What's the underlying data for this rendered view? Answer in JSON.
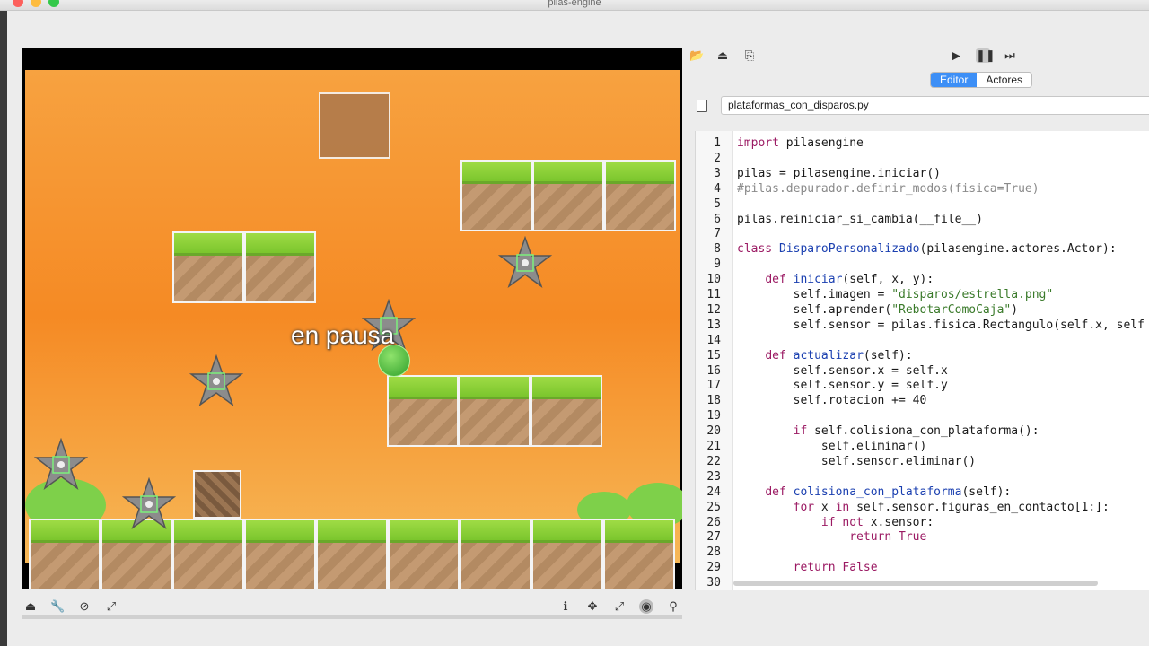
{
  "window": {
    "title": "pilas-engine"
  },
  "game": {
    "pause_label": "en pausa"
  },
  "right_panel": {
    "tabs": [
      {
        "label": "Editor",
        "active": true
      },
      {
        "label": "Actores",
        "active": false
      }
    ],
    "filename": "plataformas_con_disparos.py"
  },
  "editor": {
    "lines": [
      {
        "n": "1",
        "text": "import pilasengine"
      },
      {
        "n": "2",
        "text": ""
      },
      {
        "n": "3",
        "text": "pilas = pilasengine.iniciar()"
      },
      {
        "n": "4",
        "text": "#pilas.depurador.definir_modos(fisica=True)"
      },
      {
        "n": "5",
        "text": ""
      },
      {
        "n": "6",
        "text": "pilas.reiniciar_si_cambia(__file__)"
      },
      {
        "n": "7",
        "text": ""
      },
      {
        "n": "8",
        "text": "class DisparoPersonalizado(pilasengine.actores.Actor):"
      },
      {
        "n": "9",
        "text": ""
      },
      {
        "n": "10",
        "text": "    def iniciar(self, x, y):"
      },
      {
        "n": "11",
        "text": "        self.imagen = \"disparos/estrella.png\""
      },
      {
        "n": "12",
        "text": "        self.aprender(\"RebotarComoCaja\")"
      },
      {
        "n": "13",
        "text": "        self.sensor = pilas.fisica.Rectangulo(self.x, self"
      },
      {
        "n": "14",
        "text": ""
      },
      {
        "n": "15",
        "text": "    def actualizar(self):"
      },
      {
        "n": "16",
        "text": "        self.sensor.x = self.x"
      },
      {
        "n": "17",
        "text": "        self.sensor.y = self.y"
      },
      {
        "n": "18",
        "text": "        self.rotacion += 40"
      },
      {
        "n": "19",
        "text": ""
      },
      {
        "n": "20",
        "text": "        if self.colisiona_con_plataforma():"
      },
      {
        "n": "21",
        "text": "            self.eliminar()"
      },
      {
        "n": "22",
        "text": "            self.sensor.eliminar()"
      },
      {
        "n": "23",
        "text": ""
      },
      {
        "n": "24",
        "text": "    def colisiona_con_plataforma(self):"
      },
      {
        "n": "25",
        "text": "        for x in self.sensor.figuras_en_contacto[1:]:"
      },
      {
        "n": "26",
        "text": "            if not x.sensor:"
      },
      {
        "n": "27",
        "text": "                return True"
      },
      {
        "n": "28",
        "text": ""
      },
      {
        "n": "29",
        "text": "        return False"
      },
      {
        "n": "30",
        "text": ""
      }
    ]
  },
  "icons": {
    "top_left": [
      "folder-icon",
      "export-icon",
      "import-icon"
    ],
    "playback": [
      "play-icon",
      "pause-icon",
      "step-icon"
    ],
    "bottom_left": [
      "export-icon",
      "wrench-icon",
      "block-icon",
      "expand-icon"
    ],
    "bottom_right": [
      "info-icon",
      "move-icon",
      "resize-icon",
      "globe-icon",
      "pin-icon"
    ]
  },
  "colors": {
    "accent": "#3d8ff6",
    "sky_top": "#f7a240",
    "grass": "#7bc62d",
    "dirt": "#c49a72"
  }
}
